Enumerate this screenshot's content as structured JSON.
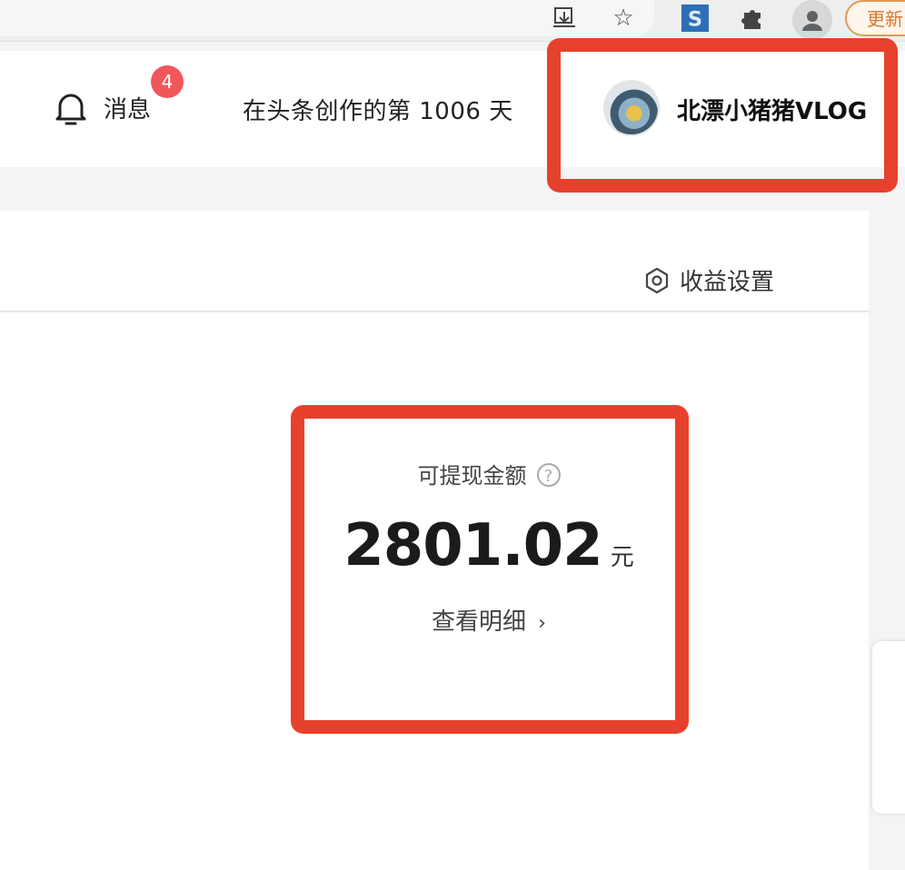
{
  "browser": {
    "update_label": "更新",
    "icons": [
      "install-icon",
      "star-icon",
      "s-extension-icon",
      "puzzle-icon",
      "profile-icon"
    ]
  },
  "header": {
    "messages_label": "消息",
    "messages_badge": "4",
    "creation_days_text": "在头条创作的第 1006 天",
    "user_name": "北漂小猪猪VLOG"
  },
  "content": {
    "settings_label": "收益设置",
    "withdrawable_label": "可提现金额",
    "amount": "2801.02",
    "unit": "元",
    "details_label": "查看明细"
  },
  "colors": {
    "highlight": "#e7412d",
    "badge": "#f0575b",
    "update_border": "#e29a57"
  }
}
